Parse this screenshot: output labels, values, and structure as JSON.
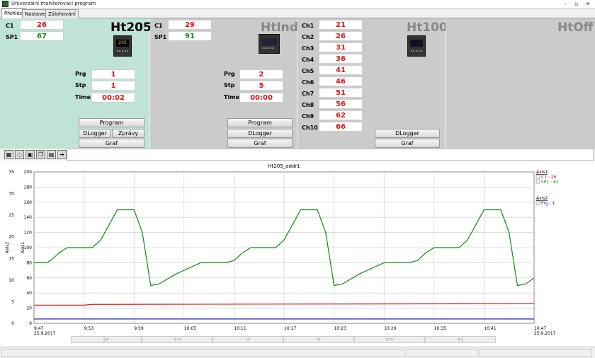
{
  "window": {
    "title": "Univerzální monitorovací program",
    "min": "–",
    "max": "▫",
    "close": "✕"
  },
  "tabs": [
    "Přehled",
    "Nastavení",
    "Zálohování"
  ],
  "colors": {
    "panel1": "#bfe4d6",
    "panel_gray": "#cbcbcb",
    "value_red": "#e01010",
    "value_green": "#0f8a0f"
  },
  "panel1": {
    "title": "Ht205",
    "c1_label": "C1",
    "c1": "26",
    "sp1_label": "SP1",
    "sp1": "67",
    "prg_label": "Prg",
    "prg": "1",
    "stp_label": "Stp",
    "stp": "1",
    "time_label": "Time",
    "time": "00:02",
    "device": "205",
    "btn_program": "Program",
    "btn_dlogger": "DLogger",
    "btn_zpravy": "Zprávy",
    "btn_graf": "Graf"
  },
  "panel2": {
    "title": "HtInd",
    "c1_label": "C1",
    "c1": "29",
    "sp1_label": "SP1",
    "sp1": "91",
    "prg_label": "Prg",
    "prg": "2",
    "stp_label": "Stp",
    "stp": "5",
    "time_label": "Time",
    "time": "00:00",
    "btn_program": "Program",
    "btn_dlogger": "DLogger",
    "btn_graf": "Graf"
  },
  "panel3": {
    "title": "Ht100",
    "channels": [
      {
        "label": "Ch1",
        "value": "21"
      },
      {
        "label": "Ch2",
        "value": "26"
      },
      {
        "label": "Ch3",
        "value": "31"
      },
      {
        "label": "Ch4",
        "value": "36"
      },
      {
        "label": "Ch5",
        "value": "41"
      },
      {
        "label": "Ch6",
        "value": "46"
      },
      {
        "label": "Ch7",
        "value": "51"
      },
      {
        "label": "Ch8",
        "value": "56"
      },
      {
        "label": "Ch9",
        "value": "62"
      },
      {
        "label": "Ch10",
        "value": "66"
      }
    ],
    "btn_dlogger": "DLogger",
    "btn_graf": "Graf"
  },
  "panel4": {
    "title": "HtOff"
  },
  "toolbar": {
    "icons": [
      "grid-icon",
      "refresh-icon",
      "open-folder-icon",
      "copy-icon",
      "print-icon",
      "export-icon"
    ],
    "glyphs": [
      "▦",
      "◌",
      "▣",
      "❐",
      "▤",
      "➔"
    ]
  },
  "nav": [
    "|<",
    "<<",
    "<",
    ">",
    ">>",
    ">|"
  ],
  "chart_data": {
    "type": "line",
    "title": "Ht205_addr1",
    "ylabel": "Axis1",
    "y2label": "Axis2",
    "ylim": [
      0,
      200
    ],
    "y2lim": [
      0,
      35
    ],
    "yticks": [
      "0",
      "20",
      "40",
      "60",
      "80",
      "100",
      "120",
      "140",
      "160",
      "180",
      "200"
    ],
    "y2ticks": [
      "0",
      "5",
      "10",
      "15",
      "20",
      "25",
      "30",
      "35"
    ],
    "x": [
      "9:47",
      "9:53",
      "9:59",
      "10:05",
      "10:11",
      "10:17",
      "10:23",
      "10:29",
      "10:35",
      "10:41",
      "10:47"
    ],
    "date_first": "25.9.2017",
    "date_last": "25.9.2017",
    "legend": {
      "axis1_title": "Axis1",
      "axis2_title": "Axis2",
      "entries": [
        {
          "label": "C1 : 26",
          "color": "#e01010"
        },
        {
          "label": "SP1 : 61",
          "color": "#0f8a0f"
        },
        {
          "label": "Prg : 1",
          "color": "#2020c0"
        }
      ]
    },
    "series": [
      {
        "name": "SP1 : 61",
        "axis": "Axis1",
        "color": "#0f8a0f",
        "points": [
          [
            0,
            80
          ],
          [
            1.5,
            80
          ],
          [
            2,
            83
          ],
          [
            3,
            93
          ],
          [
            4,
            100
          ],
          [
            7,
            100
          ],
          [
            8,
            110
          ],
          [
            9,
            130
          ],
          [
            10,
            150
          ],
          [
            12,
            150
          ],
          [
            13,
            120
          ],
          [
            14,
            50
          ],
          [
            15,
            52
          ],
          [
            17,
            65
          ],
          [
            19,
            75
          ],
          [
            20,
            80
          ],
          [
            23,
            80
          ],
          [
            24,
            83
          ],
          [
            25,
            93
          ],
          [
            26,
            100
          ],
          [
            29,
            100
          ],
          [
            30,
            110
          ],
          [
            31,
            130
          ],
          [
            32,
            150
          ],
          [
            34,
            150
          ],
          [
            35,
            120
          ],
          [
            36,
            50
          ],
          [
            37,
            52
          ],
          [
            39,
            65
          ],
          [
            41,
            75
          ],
          [
            42,
            80
          ],
          [
            45,
            80
          ],
          [
            46,
            83
          ],
          [
            47,
            93
          ],
          [
            48,
            100
          ],
          [
            51,
            100
          ],
          [
            52,
            110
          ],
          [
            53,
            130
          ],
          [
            54,
            150
          ],
          [
            56,
            150
          ],
          [
            57,
            120
          ],
          [
            58,
            50
          ],
          [
            59,
            52
          ],
          [
            60,
            60
          ]
        ]
      },
      {
        "name": "C1 : 26",
        "axis": "Axis1",
        "color": "#e01010",
        "points": [
          [
            0,
            24
          ],
          [
            6,
            24
          ],
          [
            7,
            25
          ],
          [
            60,
            26
          ]
        ]
      },
      {
        "name": "Prg : 1",
        "axis": "Axis2",
        "color": "#2020c0",
        "points": [
          [
            0,
            1
          ],
          [
            60,
            1
          ]
        ]
      }
    ]
  }
}
